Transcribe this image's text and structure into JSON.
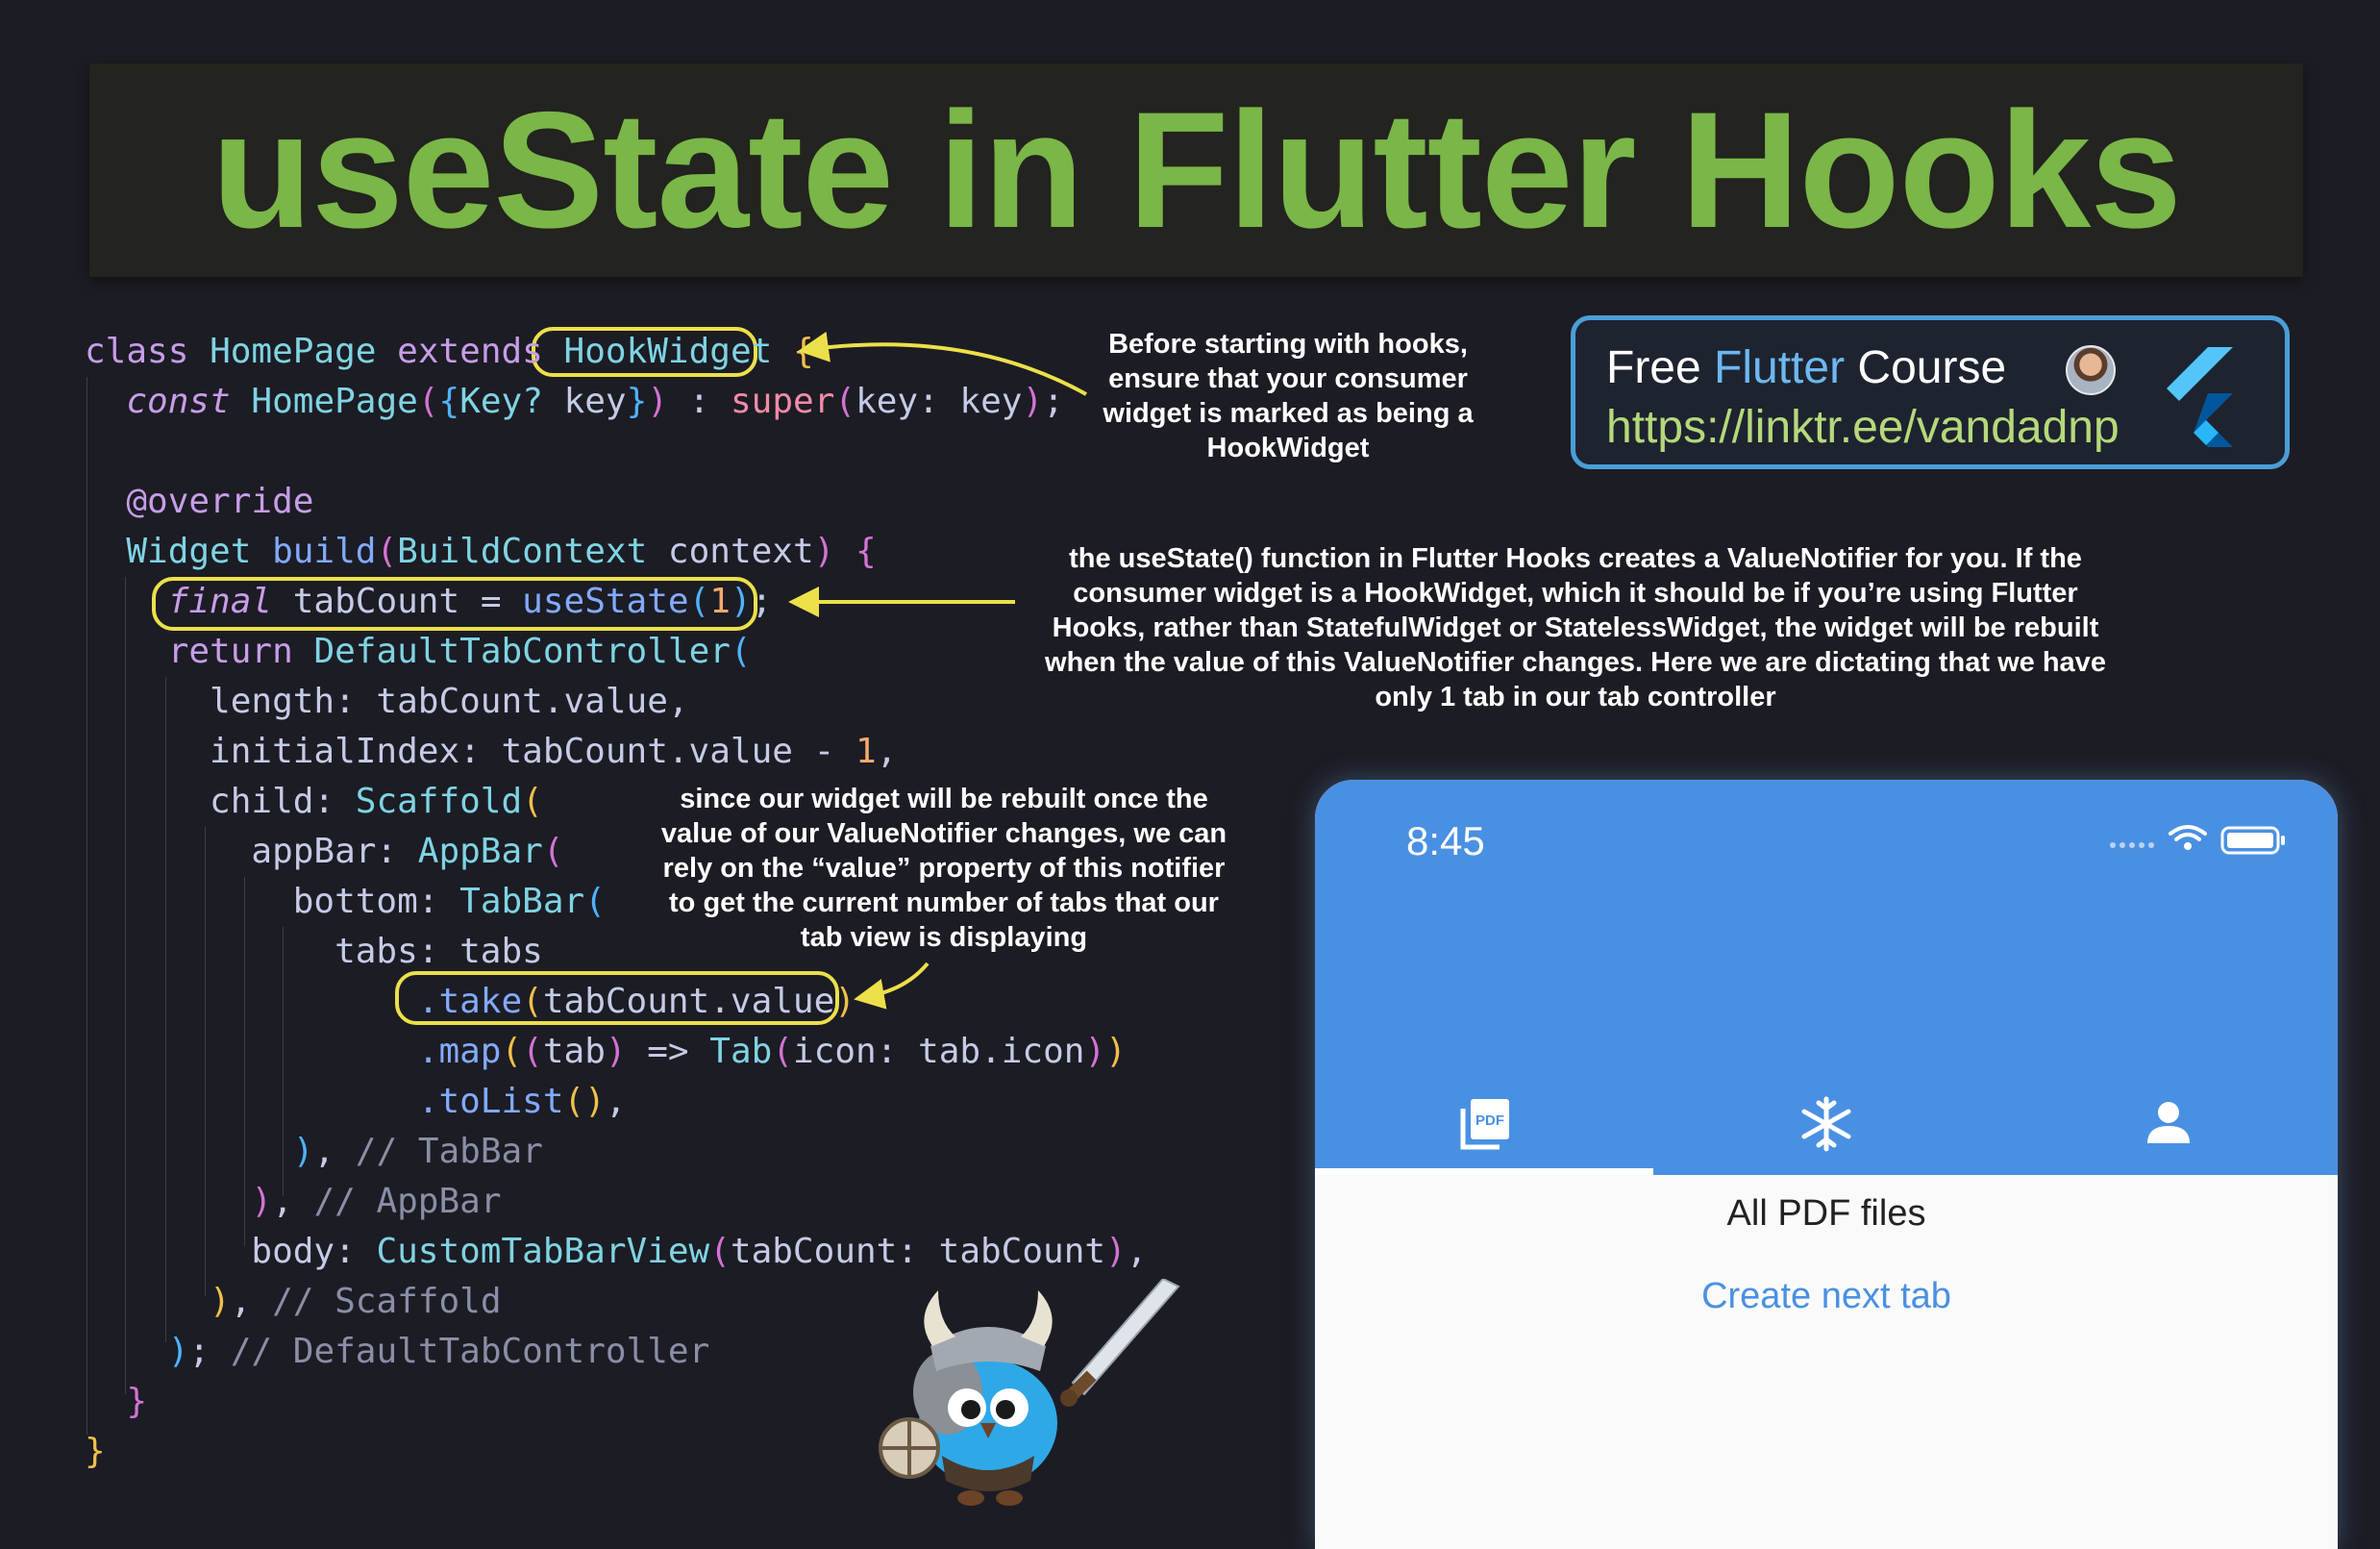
{
  "title": "useState in Flutter Hooks",
  "code_lines": [
    "class HomePage extends HookWidget {",
    "  const HomePage({Key? key}) : super(key: key);",
    "",
    "  @override",
    "  Widget build(BuildContext context) {",
    "    final tabCount = useState(1);",
    "    return DefaultTabController(",
    "      length: tabCount.value,",
    "      initialIndex: tabCount.value - 1,",
    "      child: Scaffold(",
    "        appBar: AppBar(",
    "          bottom: TabBar(",
    "            tabs: tabs",
    "                .take(tabCount.value)",
    "                .map((tab) => Tab(icon: tab.icon))",
    "                .toList(),",
    "          ), // TabBar",
    "        ), // AppBar",
    "        body: CustomTabBarView(tabCount: tabCount),",
    "      ), // Scaffold",
    "    ); // DefaultTabController",
    "  }",
    "}"
  ],
  "annotations": {
    "hookwidget": "Before starting with hooks, ensure that your consumer widget is marked as being a HookWidget",
    "usestate": "the useState() function in Flutter Hooks creates a ValueNotifier for you. If the consumer widget is a HookWidget, which it should be if you’re using Flutter Hooks, rather than StatefulWidget or StatelessWidget, the widget will be rebuilt when the value of this ValueNotifier changes. Here we are dictating that we have only 1 tab in our tab controller",
    "take": "since our widget will be rebuilt once the value of our ValueNotifier changes, we can rely on the “value” property of this notifier to get the current number of tabs that our tab view is displaying"
  },
  "course_card": {
    "prefix": "Free ",
    "highlight": "Flutter",
    "suffix": " Course",
    "link": "https://linktr.ee/vandadnp"
  },
  "phone": {
    "time": "8:45",
    "tabs": [
      {
        "icon": "pdf-icon",
        "selected": true
      },
      {
        "icon": "snowflake-icon",
        "selected": false
      },
      {
        "icon": "person-icon",
        "selected": false
      }
    ],
    "body_title": "All PDF files",
    "button_label": "Create next tab"
  },
  "colors": {
    "background": "#1c1c24",
    "title_green": "#7ab648",
    "highlight_yellow": "#ece04a",
    "app_blue": "#4a90e2",
    "card_border": "#4b9ed6"
  }
}
